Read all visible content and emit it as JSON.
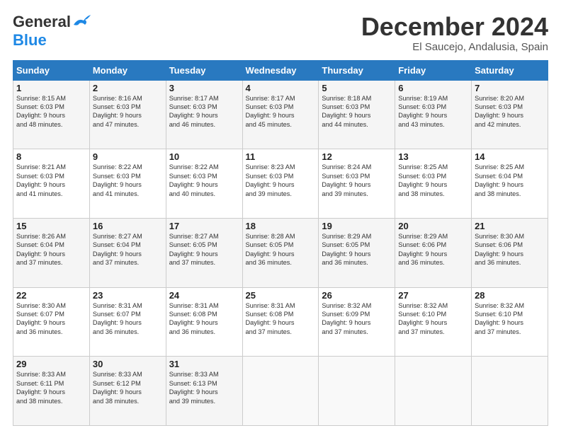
{
  "header": {
    "logo": {
      "part1": "General",
      "part2": "Blue"
    },
    "title": "December 2024",
    "location": "El Saucejo, Andalusia, Spain"
  },
  "weekdays": [
    "Sunday",
    "Monday",
    "Tuesday",
    "Wednesday",
    "Thursday",
    "Friday",
    "Saturday"
  ],
  "weeks": [
    [
      {
        "day": "1",
        "lines": [
          "Sunrise: 8:15 AM",
          "Sunset: 6:03 PM",
          "Daylight: 9 hours",
          "and 48 minutes."
        ]
      },
      {
        "day": "2",
        "lines": [
          "Sunrise: 8:16 AM",
          "Sunset: 6:03 PM",
          "Daylight: 9 hours",
          "and 47 minutes."
        ]
      },
      {
        "day": "3",
        "lines": [
          "Sunrise: 8:17 AM",
          "Sunset: 6:03 PM",
          "Daylight: 9 hours",
          "and 46 minutes."
        ]
      },
      {
        "day": "4",
        "lines": [
          "Sunrise: 8:17 AM",
          "Sunset: 6:03 PM",
          "Daylight: 9 hours",
          "and 45 minutes."
        ]
      },
      {
        "day": "5",
        "lines": [
          "Sunrise: 8:18 AM",
          "Sunset: 6:03 PM",
          "Daylight: 9 hours",
          "and 44 minutes."
        ]
      },
      {
        "day": "6",
        "lines": [
          "Sunrise: 8:19 AM",
          "Sunset: 6:03 PM",
          "Daylight: 9 hours",
          "and 43 minutes."
        ]
      },
      {
        "day": "7",
        "lines": [
          "Sunrise: 8:20 AM",
          "Sunset: 6:03 PM",
          "Daylight: 9 hours",
          "and 42 minutes."
        ]
      }
    ],
    [
      {
        "day": "8",
        "lines": [
          "Sunrise: 8:21 AM",
          "Sunset: 6:03 PM",
          "Daylight: 9 hours",
          "and 41 minutes."
        ]
      },
      {
        "day": "9",
        "lines": [
          "Sunrise: 8:22 AM",
          "Sunset: 6:03 PM",
          "Daylight: 9 hours",
          "and 41 minutes."
        ]
      },
      {
        "day": "10",
        "lines": [
          "Sunrise: 8:22 AM",
          "Sunset: 6:03 PM",
          "Daylight: 9 hours",
          "and 40 minutes."
        ]
      },
      {
        "day": "11",
        "lines": [
          "Sunrise: 8:23 AM",
          "Sunset: 6:03 PM",
          "Daylight: 9 hours",
          "and 39 minutes."
        ]
      },
      {
        "day": "12",
        "lines": [
          "Sunrise: 8:24 AM",
          "Sunset: 6:03 PM",
          "Daylight: 9 hours",
          "and 39 minutes."
        ]
      },
      {
        "day": "13",
        "lines": [
          "Sunrise: 8:25 AM",
          "Sunset: 6:03 PM",
          "Daylight: 9 hours",
          "and 38 minutes."
        ]
      },
      {
        "day": "14",
        "lines": [
          "Sunrise: 8:25 AM",
          "Sunset: 6:04 PM",
          "Daylight: 9 hours",
          "and 38 minutes."
        ]
      }
    ],
    [
      {
        "day": "15",
        "lines": [
          "Sunrise: 8:26 AM",
          "Sunset: 6:04 PM",
          "Daylight: 9 hours",
          "and 37 minutes."
        ]
      },
      {
        "day": "16",
        "lines": [
          "Sunrise: 8:27 AM",
          "Sunset: 6:04 PM",
          "Daylight: 9 hours",
          "and 37 minutes."
        ]
      },
      {
        "day": "17",
        "lines": [
          "Sunrise: 8:27 AM",
          "Sunset: 6:05 PM",
          "Daylight: 9 hours",
          "and 37 minutes."
        ]
      },
      {
        "day": "18",
        "lines": [
          "Sunrise: 8:28 AM",
          "Sunset: 6:05 PM",
          "Daylight: 9 hours",
          "and 36 minutes."
        ]
      },
      {
        "day": "19",
        "lines": [
          "Sunrise: 8:29 AM",
          "Sunset: 6:05 PM",
          "Daylight: 9 hours",
          "and 36 minutes."
        ]
      },
      {
        "day": "20",
        "lines": [
          "Sunrise: 8:29 AM",
          "Sunset: 6:06 PM",
          "Daylight: 9 hours",
          "and 36 minutes."
        ]
      },
      {
        "day": "21",
        "lines": [
          "Sunrise: 8:30 AM",
          "Sunset: 6:06 PM",
          "Daylight: 9 hours",
          "and 36 minutes."
        ]
      }
    ],
    [
      {
        "day": "22",
        "lines": [
          "Sunrise: 8:30 AM",
          "Sunset: 6:07 PM",
          "Daylight: 9 hours",
          "and 36 minutes."
        ]
      },
      {
        "day": "23",
        "lines": [
          "Sunrise: 8:31 AM",
          "Sunset: 6:07 PM",
          "Daylight: 9 hours",
          "and 36 minutes."
        ]
      },
      {
        "day": "24",
        "lines": [
          "Sunrise: 8:31 AM",
          "Sunset: 6:08 PM",
          "Daylight: 9 hours",
          "and 36 minutes."
        ]
      },
      {
        "day": "25",
        "lines": [
          "Sunrise: 8:31 AM",
          "Sunset: 6:08 PM",
          "Daylight: 9 hours",
          "and 37 minutes."
        ]
      },
      {
        "day": "26",
        "lines": [
          "Sunrise: 8:32 AM",
          "Sunset: 6:09 PM",
          "Daylight: 9 hours",
          "and 37 minutes."
        ]
      },
      {
        "day": "27",
        "lines": [
          "Sunrise: 8:32 AM",
          "Sunset: 6:10 PM",
          "Daylight: 9 hours",
          "and 37 minutes."
        ]
      },
      {
        "day": "28",
        "lines": [
          "Sunrise: 8:32 AM",
          "Sunset: 6:10 PM",
          "Daylight: 9 hours",
          "and 37 minutes."
        ]
      }
    ],
    [
      {
        "day": "29",
        "lines": [
          "Sunrise: 8:33 AM",
          "Sunset: 6:11 PM",
          "Daylight: 9 hours",
          "and 38 minutes."
        ]
      },
      {
        "day": "30",
        "lines": [
          "Sunrise: 8:33 AM",
          "Sunset: 6:12 PM",
          "Daylight: 9 hours",
          "and 38 minutes."
        ]
      },
      {
        "day": "31",
        "lines": [
          "Sunrise: 8:33 AM",
          "Sunset: 6:13 PM",
          "Daylight: 9 hours",
          "and 39 minutes."
        ]
      },
      null,
      null,
      null,
      null
    ]
  ]
}
